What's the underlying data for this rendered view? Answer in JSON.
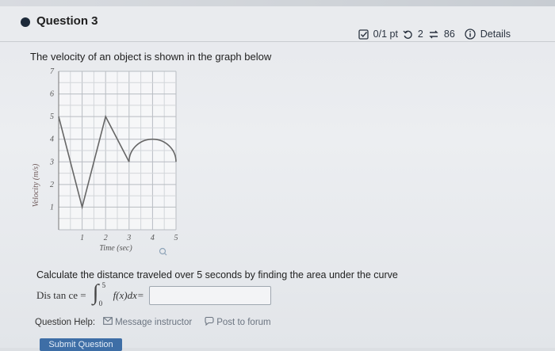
{
  "question": {
    "title": "Question 3",
    "score": "0/1 pt",
    "retries": "2",
    "attempts": "86",
    "details_label": "Details"
  },
  "prompt": "The velocity of an object is shown in the graph below",
  "graph": {
    "y_axis_label": "Velocity (m/s)",
    "x_axis_label": "Time (sec)",
    "y_ticks": [
      "1",
      "2",
      "3",
      "4",
      "5",
      "6",
      "7"
    ],
    "x_ticks": [
      "1",
      "2",
      "3",
      "4",
      "5"
    ]
  },
  "chart_data": {
    "type": "line",
    "xlabel": "Time (sec)",
    "ylabel": "Velocity (m/s)",
    "xlim": [
      0,
      5
    ],
    "ylim": [
      0,
      7
    ],
    "grid": true,
    "series": [
      {
        "points": [
          [
            0,
            5
          ],
          [
            1,
            1
          ],
          [
            2,
            5
          ],
          [
            3,
            3
          ]
        ]
      },
      {
        "semicircle": {
          "center": [
            4,
            3
          ],
          "radius": 1
        }
      }
    ]
  },
  "calculate_text": "Calculate the distance traveled over 5 seconds by finding the area under the curve",
  "distance": {
    "label": "Dis tan ce =",
    "upper_limit": "5",
    "lower_limit": "0",
    "integrand": "f(x)dx=",
    "answer": ""
  },
  "help": {
    "label": "Question Help:",
    "message_label": "Message instructor",
    "post_label": "Post to forum"
  },
  "submit_label": "Submit Question"
}
